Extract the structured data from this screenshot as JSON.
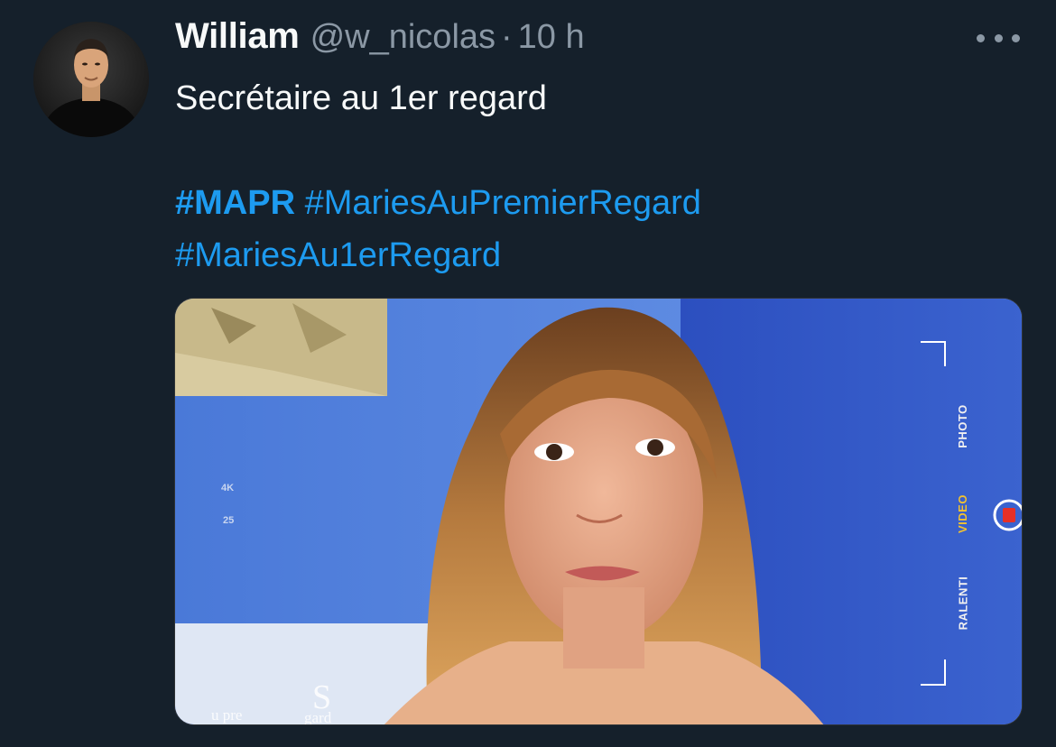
{
  "tweet": {
    "display_name": "William",
    "handle": "@w_nicolas",
    "separator": "·",
    "time": "10 h",
    "text_line1": "Secrétaire au 1er regard",
    "hashtags": [
      "#MAPR",
      "#MariesAuPremierRegard",
      "#MariesAu1erRegard"
    ]
  },
  "media": {
    "camera_modes": [
      "PHOTO",
      "VIDEO",
      "RALENTI"
    ],
    "active_mode": "VIDEO",
    "resolution": "4K",
    "framerate": "25",
    "watermark_top": "S",
    "watermark_left": "u pre",
    "watermark_right": "gard"
  },
  "icons": {
    "more": "more-horizontal-icon",
    "record": "record-button-icon"
  },
  "colors": {
    "background": "#15202b",
    "hashtag": "#1d9bf0",
    "secondary_text": "#8b98a5",
    "primary_text": "#f7f9f9",
    "active_mode": "#f2c230"
  }
}
